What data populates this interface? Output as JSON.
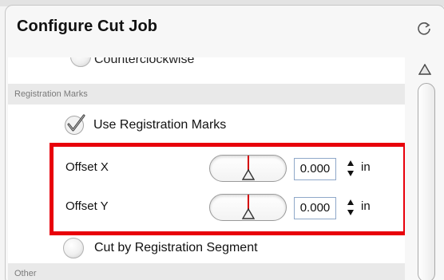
{
  "header": {
    "title": "Configure Cut Job"
  },
  "direction_option": {
    "label": "Counterclockwise"
  },
  "sections": {
    "registration": "Registration Marks",
    "other": "Other"
  },
  "use_registration_marks": {
    "label": "Use Registration Marks",
    "checked": true
  },
  "offset_x": {
    "label": "Offset X",
    "value": "0.000",
    "unit": "in"
  },
  "offset_y": {
    "label": "Offset Y",
    "value": "0.000",
    "unit": "in"
  },
  "cut_by_segment": {
    "label": "Cut by Registration Segment",
    "checked": false
  },
  "colors": {
    "highlight": "#e8000b",
    "slider_tick": "#d50000"
  }
}
